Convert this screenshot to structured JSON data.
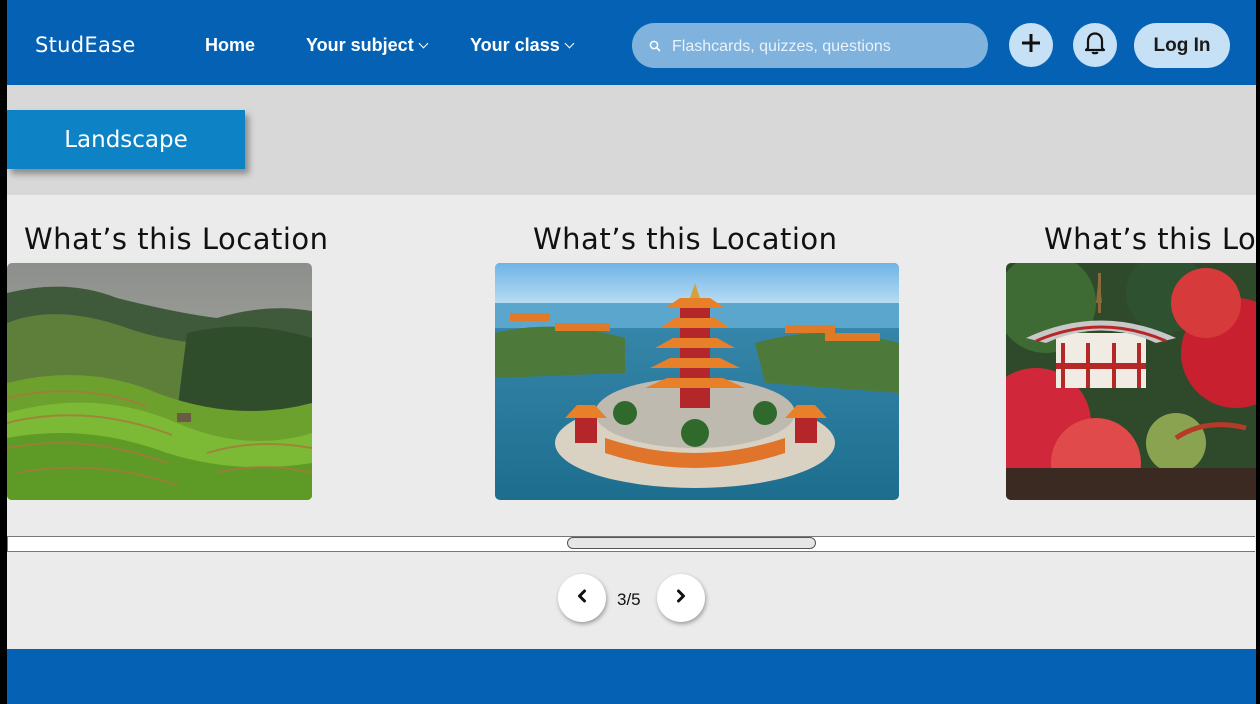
{
  "header": {
    "brand": "StudEase",
    "nav": {
      "home": "Home",
      "subject": "Your subject",
      "class": "Your class"
    },
    "search_placeholder": "Flashcards, quizzes, questions",
    "login_label": "Log In"
  },
  "category": {
    "label": "Landscape"
  },
  "cards": [
    {
      "title": "What’s this Location",
      "image": "rice-terraces-photo"
    },
    {
      "title": "What’s this Location",
      "image": "chinese-pagoda-island-photo"
    },
    {
      "title": "What’s this Location",
      "image": "japanese-temple-autumn-photo"
    }
  ],
  "pager": {
    "current": "3",
    "total": "5",
    "display": "3/5"
  },
  "colors": {
    "primary": "#0561b4",
    "accent_tag": "#0d83c6",
    "button_light": "#c6e0f5",
    "search_bg": "#7fb2dd"
  },
  "icons": {
    "search": "search-icon",
    "plus": "plus-icon",
    "bell": "bell-icon",
    "prev": "chevron-left-icon",
    "next": "chevron-right-icon"
  }
}
